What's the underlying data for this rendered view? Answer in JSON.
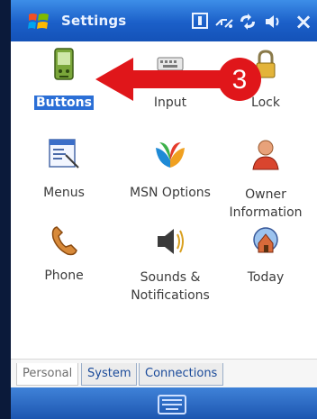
{
  "titlebar": {
    "title": "Settings",
    "icons": [
      "start-logo-icon",
      "input-panel-icon",
      "connectivity-icon",
      "sync-icon",
      "volume-icon",
      "close-icon"
    ],
    "close_glyph": "×"
  },
  "items": [
    {
      "label": "Buttons",
      "icon": "buttons-icon",
      "selected": true
    },
    {
      "label": "Input",
      "icon": "input-icon"
    },
    {
      "label": "Lock",
      "icon": "lock-icon"
    },
    {
      "label": "Menus",
      "icon": "menus-icon"
    },
    {
      "label": "MSN Options",
      "icon": "msn-butterfly-icon"
    },
    {
      "label": "Owner",
      "label2": "Information",
      "icon": "owner-icon"
    },
    {
      "label": "Phone",
      "icon": "phone-icon"
    },
    {
      "label": "Sounds &",
      "label2": "Notifications",
      "icon": "speaker-icon"
    },
    {
      "label": "Today",
      "icon": "today-icon"
    }
  ],
  "tabs": [
    {
      "label": "Personal",
      "active": true
    },
    {
      "label": "System"
    },
    {
      "label": "Connections"
    }
  ],
  "bottombar": {
    "icon": "keyboard-icon"
  },
  "annotation": {
    "step": "3",
    "color": "#e0161a"
  }
}
